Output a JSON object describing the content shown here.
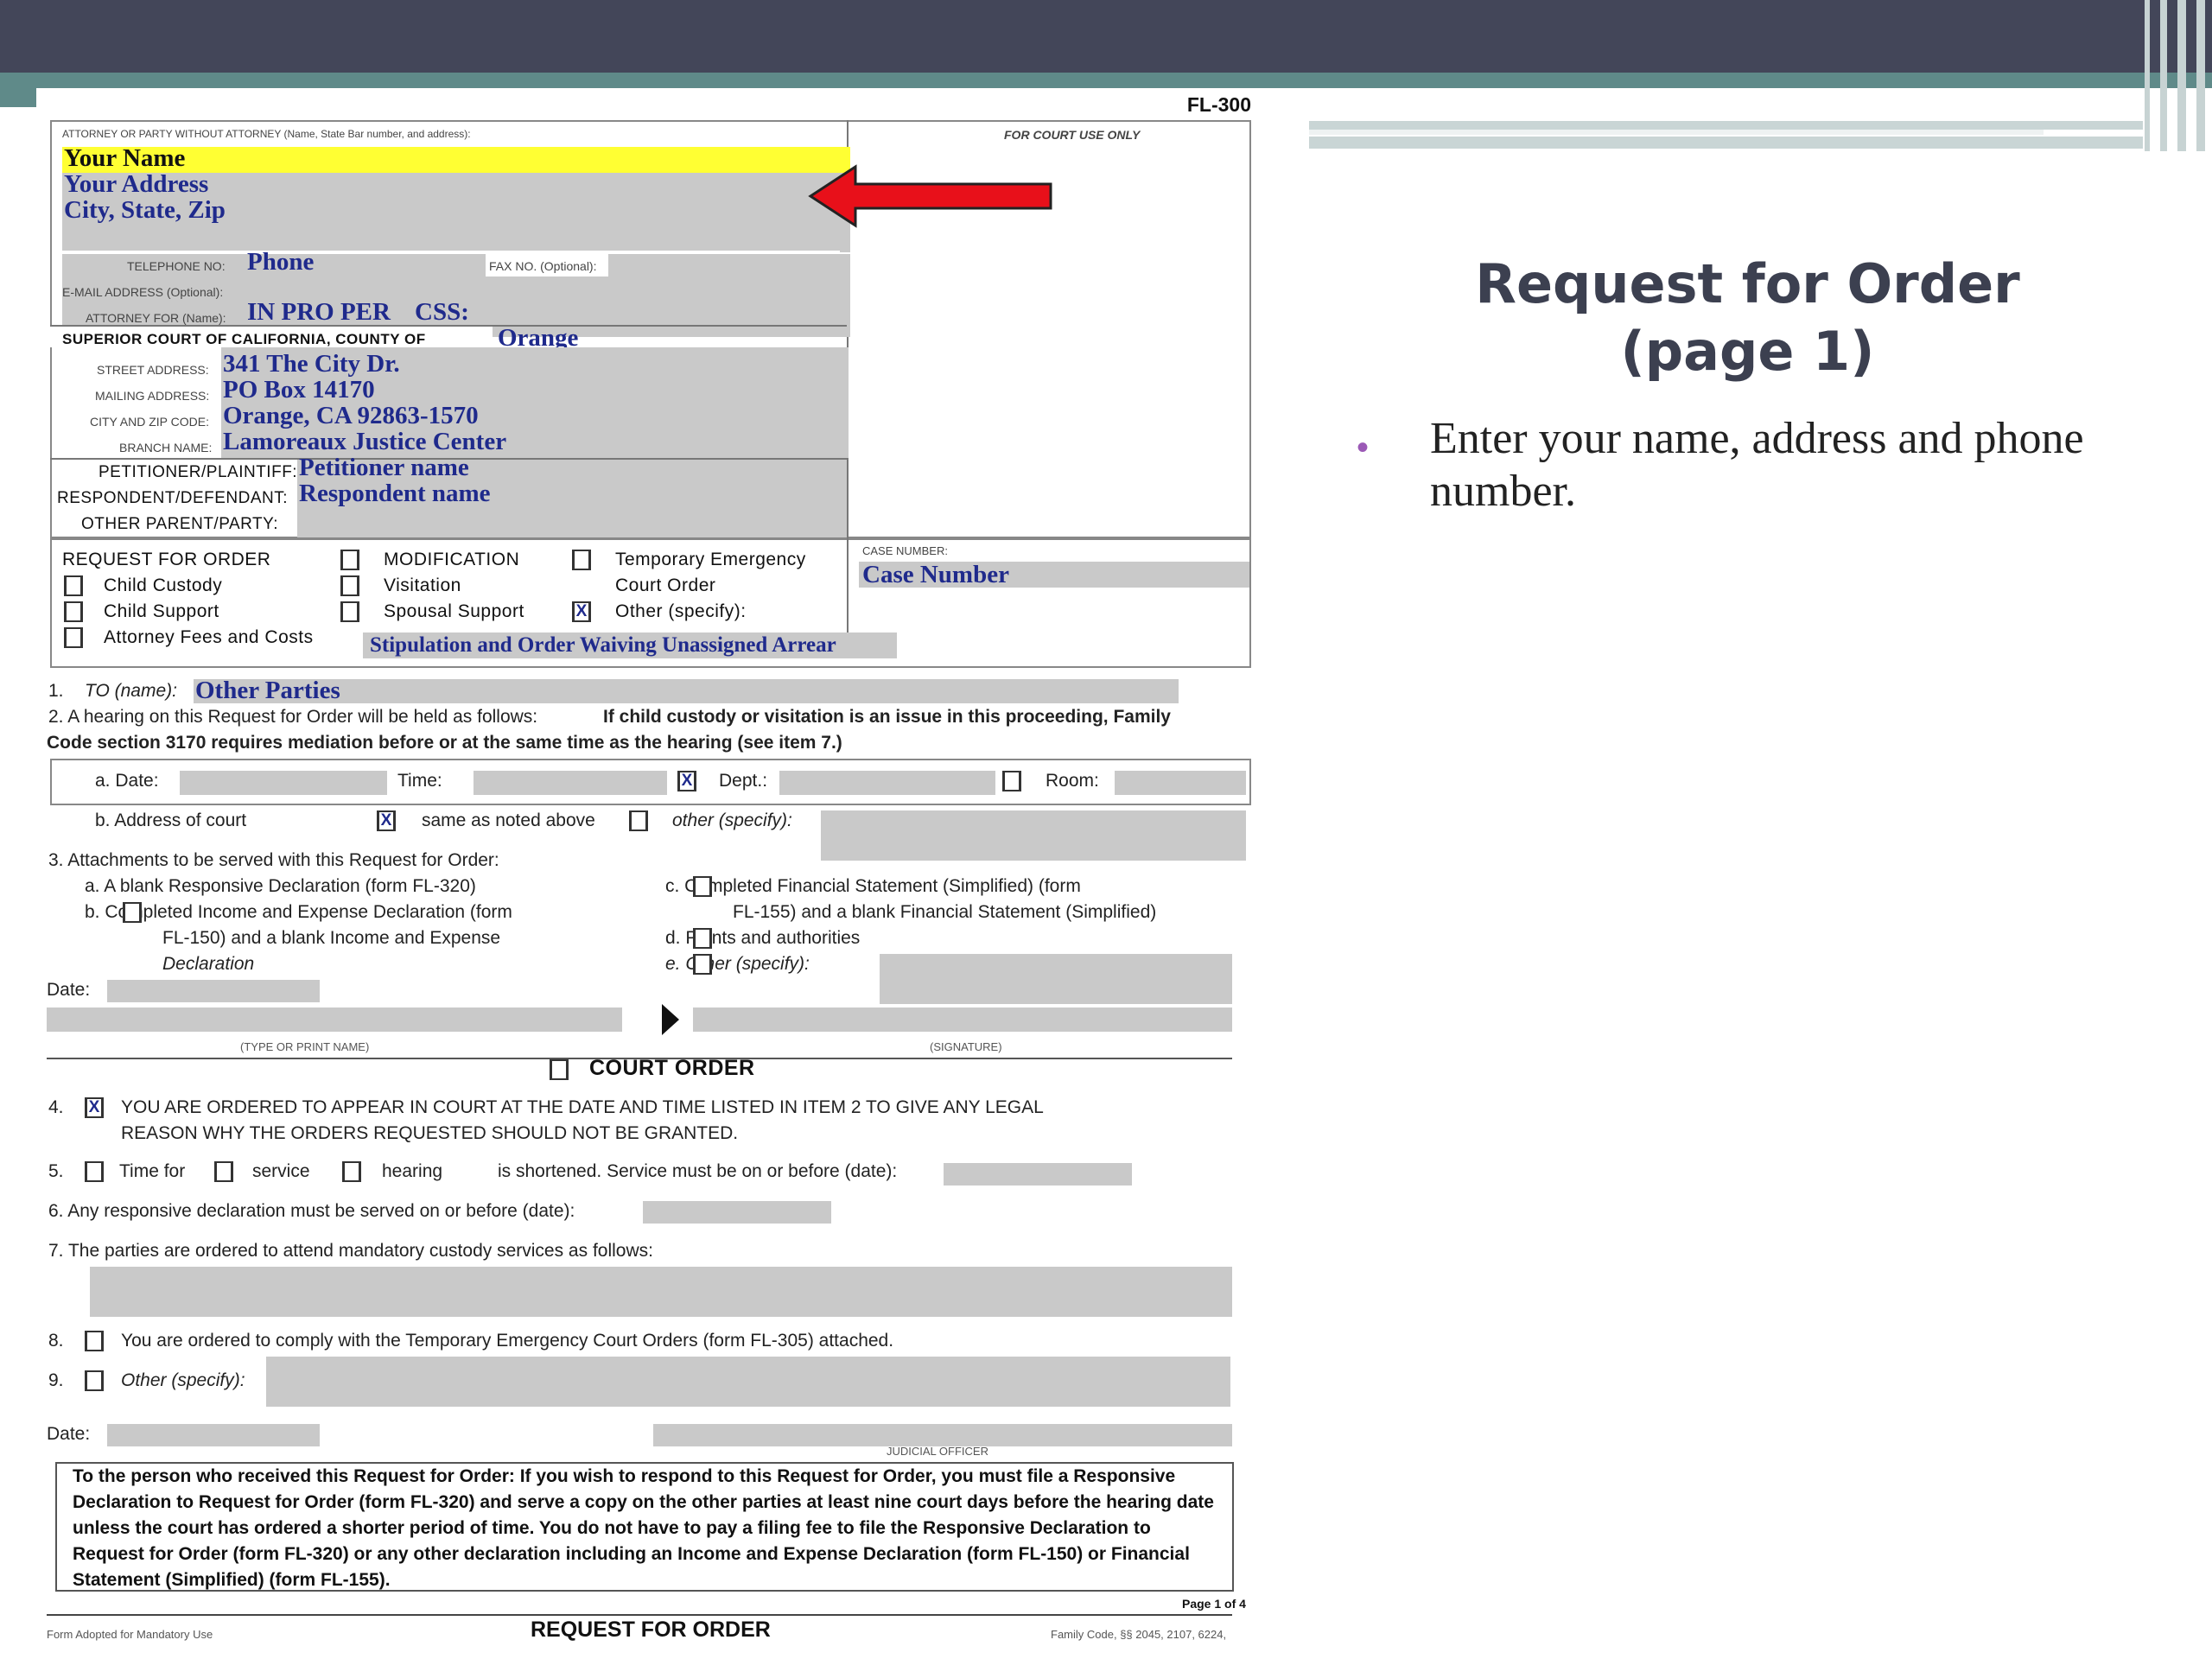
{
  "slide": {
    "title_line1": "Request for Order",
    "title_line2": "(page 1)",
    "bullet": "Enter your name, address and phone number.",
    "accent_color": "#9b59b6",
    "topbar_color": "#434659",
    "teal_color": "#5f8a89"
  },
  "form": {
    "form_id": "FL-300",
    "attorney_label": "ATTORNEY OR PARTY WITHOUT ATTORNEY (Name, State Bar number, and address):",
    "court_use_only": "FOR COURT USE ONLY",
    "your_name": "Your Name",
    "your_address": "Your Address",
    "city_state_zip": "City, State, Zip",
    "telephone_label": "TELEPHONE NO:",
    "phone": "Phone",
    "fax_label": "FAX NO. (Optional):",
    "email_label": "E-MAIL ADDRESS (Optional):",
    "attorney_for_label": "ATTORNEY FOR (Name):",
    "attorney_for": "IN PRO PER",
    "css": "CSS:",
    "superior_court_label": "SUPERIOR COURT OF CALIFORNIA, COUNTY OF",
    "county": "Orange",
    "street_label": "STREET ADDRESS:",
    "street": "341 The City Dr.",
    "mailing_label": "MAILING ADDRESS:",
    "mailing": "PO Box 14170",
    "city_zip_label": "CITY AND ZIP CODE:",
    "city_zip": "Orange, CA  92863-1570",
    "branch_label": "BRANCH NAME:",
    "branch": "Lamoreaux Justice Center",
    "petitioner_label": "PETITIONER/PLAINTIFF:",
    "petitioner": "Petitioner name",
    "respondent_label": "RESPONDENT/DEFENDANT:",
    "respondent": "Respondent name",
    "other_parent_label": "OTHER PARENT/PARTY:",
    "rfo_heading": "REQUEST FOR ORDER",
    "child_custody": "Child Custody",
    "child_support": "Child Support",
    "attorney_fees": "Attorney Fees and Costs",
    "modification": "MODIFICATION",
    "visitation": "Visitation",
    "spousal_support": "Spousal Support",
    "temp_emergency_1": "Temporary Emergency",
    "temp_emergency_2": "Court Order",
    "other_specify": "Other (specify):",
    "other_specify_value": "Stipulation and Order Waiving Unassigned Arrear",
    "case_number_label": "CASE NUMBER:",
    "case_number": "Case Number",
    "checked_mark": "X",
    "item1_num": "1.",
    "item1_label": "TO (name):",
    "item1_value": "Other Parties",
    "item2_line1_a": "2.   A hearing on this Request for Order will be held as follows:",
    "item2_line1_b": "If child custody or visitation is an issue in this proceeding, Family",
    "item2_line2": "Code section 3170 requires mediation before or at the same time as the hearing (see item 7.)",
    "date_label": "a.  Date:",
    "time_label": "Time:",
    "dept_label": "Dept.:",
    "room_label": "Room:",
    "address_court": "b.  Address of court",
    "same_as_above": "same as noted above",
    "other_spec2": "other (specify):",
    "item3": "3.    Attachments to be served with this Request for Order:",
    "item3a": "a.    A blank Responsive Declaration (form FL-320)",
    "item3b_1": "b.          Completed Income and Expense Declaration (form",
    "item3b_2": "FL-150) and a blank Income and Expense",
    "item3b_3": "Declaration",
    "item3c_1": "c.          Completed Financial Statement (Simplified) (form",
    "item3c_2": "FL-155) and a blank Financial Statement (Simplified)",
    "item3d": "d.          Points and authorities",
    "item3e": "e.          Other (specify):",
    "date_short": "Date:",
    "type_name": "(TYPE OR PRINT NAME)",
    "signature": "(SIGNATURE)",
    "court_order": "COURT ORDER",
    "item4_1": "YOU ARE ORDERED TO APPEAR IN COURT AT THE DATE AND TIME LISTED IN ITEM 2 TO GIVE ANY LEGAL",
    "item4_2": "REASON WHY THE ORDERS REQUESTED SHOULD NOT BE GRANTED.",
    "item5_a": "Time for",
    "item5_b": "service",
    "item5_c": "hearing",
    "item5_d": "is shortened. Service must be on or before (date):",
    "item6": "6.    Any responsive declaration must be served on or before (date):",
    "item7": "7.    The parties are ordered to attend mandatory custody services as follows:",
    "item8": "You are ordered to comply with the Temporary Emergency Court Orders (form FL-305) attached.",
    "item9": "Other (specify):",
    "judicial_officer": "JUDICIAL OFFICER",
    "notice": "To the person who received this Request for Order: If you wish to respond to this Request for Order, you must file a Responsive Declaration to Request for Order (form FL-320) and serve a copy on the other parties at least nine court days before the hearing date unless the court has ordered a shorter period of time. You do not have to pay a filing fee to file the Responsive Declaration to Request for Order (form FL-320) or any other declaration including an Income and Expense Declaration (form FL-150) or Financial Statement (Simplified) (form FL-155).",
    "page_of": "Page 1 of 4",
    "footer_left": "Form Adopted for Mandatory Use",
    "footer_center": "REQUEST FOR ORDER",
    "footer_right": "Family Code, §§ 2045, 2107, 6224,"
  }
}
